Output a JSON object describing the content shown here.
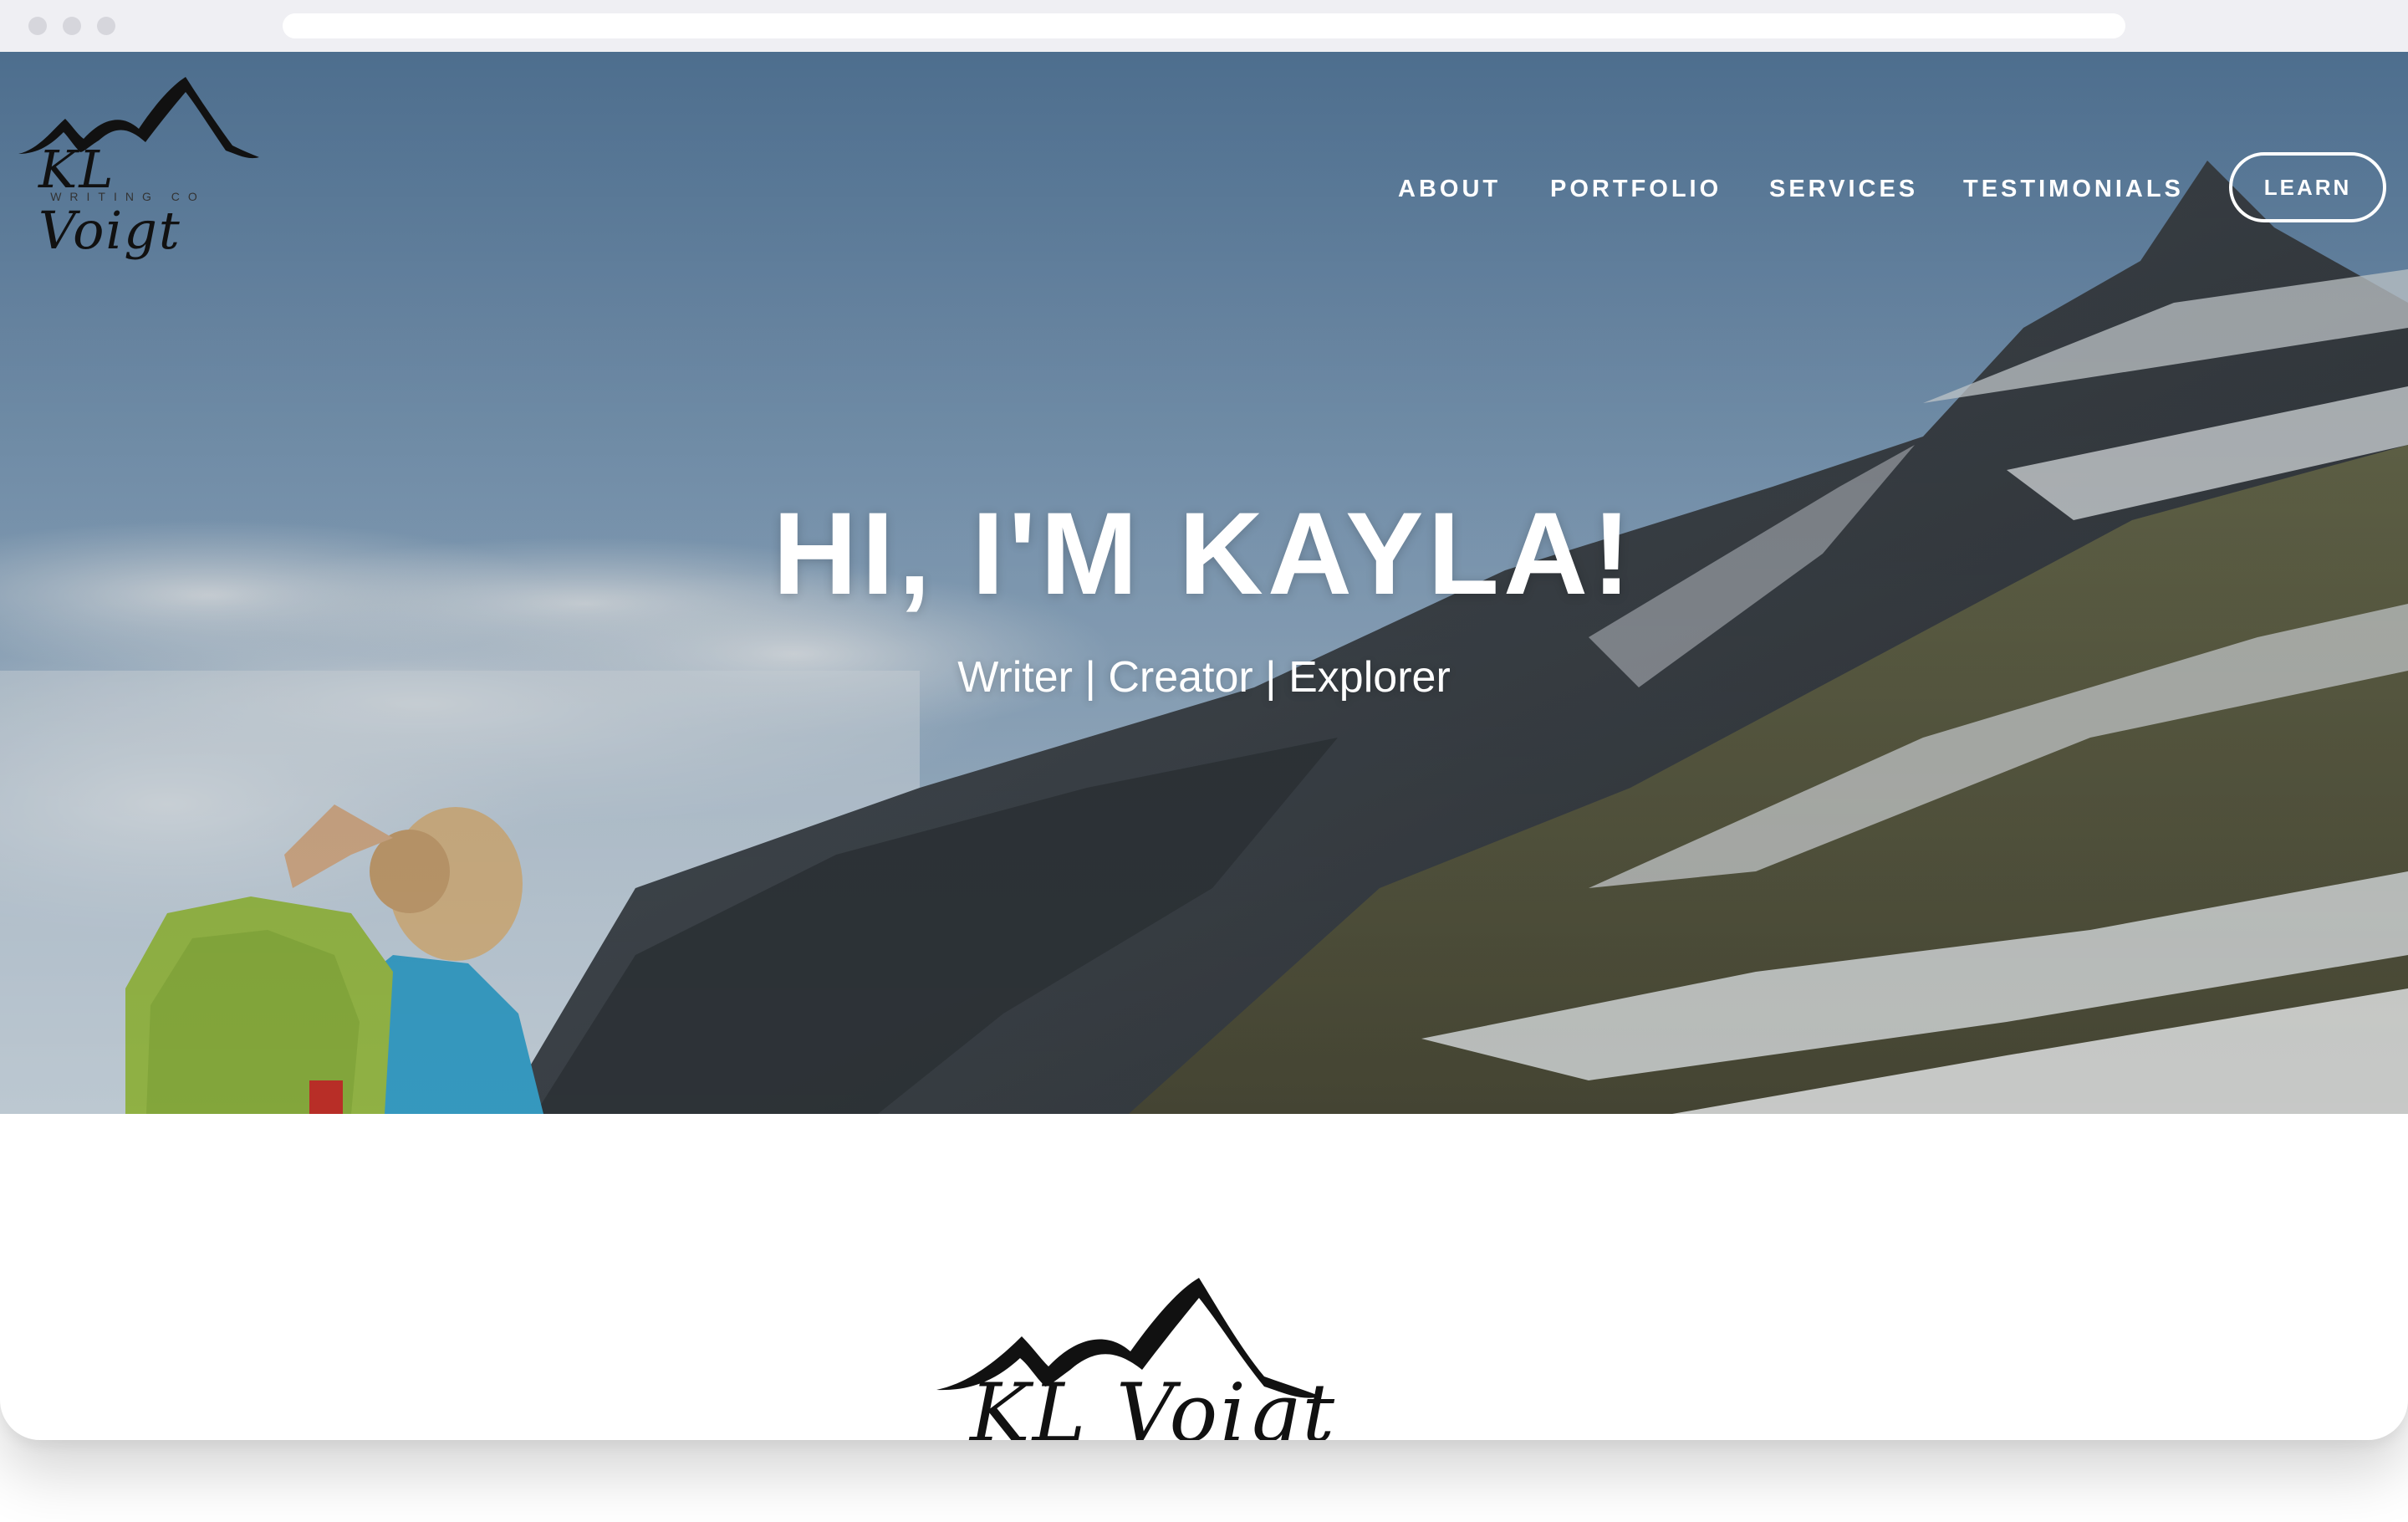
{
  "brand": {
    "logo_text": "KL Voigt",
    "logo_subtext": "WRITING CO"
  },
  "nav": {
    "items": [
      {
        "label": "ABOUT"
      },
      {
        "label": "PORTFOLIO"
      },
      {
        "label": "SERVICES"
      },
      {
        "label": "TESTIMONIALS"
      }
    ],
    "cta_label": "LEARN"
  },
  "hero": {
    "headline": "HI, I'M KAYLA!",
    "tagline": "Writer | Creator | Explorer"
  },
  "colors": {
    "sky_top": "#5e86ad",
    "sky_bottom": "#a9c1d6",
    "nav_text": "#ffffff",
    "logo_ink": "#111111"
  },
  "icons": {
    "logo_mark": "mountain-peaks-icon",
    "window_buttons": [
      "window-dot-icon",
      "window-dot-icon",
      "window-dot-icon"
    ]
  }
}
